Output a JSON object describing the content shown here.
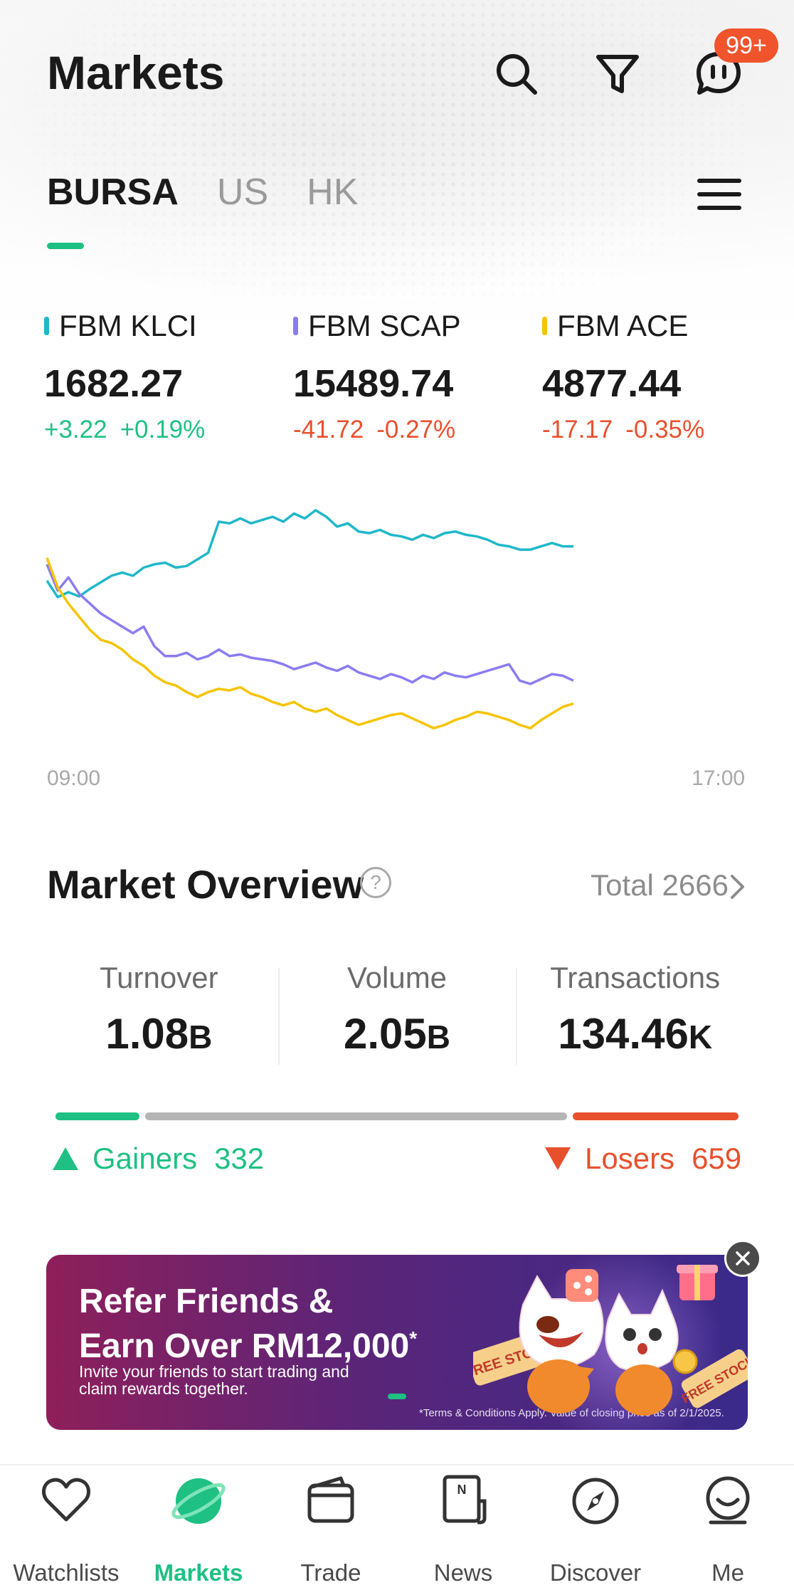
{
  "header": {
    "title": "Markets",
    "search_icon": "search-icon",
    "filter_icon": "filter-icon",
    "messages_icon": "chat-icon",
    "messages_badge": "99+"
  },
  "tabs": [
    {
      "label": "BURSA",
      "active": true
    },
    {
      "label": "US",
      "active": false
    },
    {
      "label": "HK",
      "active": false
    }
  ],
  "indices": [
    {
      "name": "FBM KLCI",
      "value": "1682.27",
      "change": "+3.22",
      "change_pct": "+0.19%",
      "color": "#1fb8c9",
      "direction": "up"
    },
    {
      "name": "FBM SCAP",
      "value": "15489.74",
      "change": "-41.72",
      "change_pct": "-0.27%",
      "color": "#8b7cf0",
      "direction": "down"
    },
    {
      "name": "FBM ACE",
      "value": "4877.44",
      "change": "-17.17",
      "change_pct": "-0.35%",
      "color": "#f5c400",
      "direction": "down"
    }
  ],
  "chart_data": {
    "type": "line",
    "x_start": "09:00",
    "x_end": "17:00",
    "series": [
      {
        "name": "FBM KLCI",
        "color": "#1fb8c9",
        "values": [
          0.3,
          -0.2,
          -0.05,
          -0.18,
          0.05,
          0.25,
          0.45,
          0.55,
          0.45,
          0.7,
          0.8,
          0.85,
          0.7,
          0.75,
          0.95,
          1.15,
          2.1,
          2.05,
          2.2,
          2.05,
          2.15,
          2.25,
          2.1,
          2.35,
          2.2,
          2.45,
          2.25,
          1.95,
          2.05,
          1.8,
          1.75,
          1.85,
          1.7,
          1.65,
          1.55,
          1.7,
          1.6,
          1.75,
          1.8,
          1.7,
          1.65,
          1.55,
          1.4,
          1.35,
          1.25,
          1.25,
          1.35,
          1.45,
          1.35,
          1.35
        ]
      },
      {
        "name": "FBM SCAP",
        "color": "#8b7cf0",
        "values": [
          0.8,
          0.0,
          0.4,
          -0.1,
          -0.4,
          -0.7,
          -0.9,
          -1.1,
          -1.3,
          -1.1,
          -1.7,
          -2.0,
          -2.0,
          -1.9,
          -2.1,
          -2.0,
          -1.8,
          -2.0,
          -1.95,
          -2.05,
          -2.1,
          -2.15,
          -2.25,
          -2.4,
          -2.3,
          -2.2,
          -2.35,
          -2.45,
          -2.3,
          -2.5,
          -2.6,
          -2.7,
          -2.55,
          -2.65,
          -2.8,
          -2.6,
          -2.7,
          -2.5,
          -2.6,
          -2.65,
          -2.55,
          -2.45,
          -2.35,
          -2.25,
          -2.75,
          -2.85,
          -2.7,
          -2.55,
          -2.6,
          -2.75
        ]
      },
      {
        "name": "FBM ACE",
        "color": "#f5c400",
        "values": [
          1.0,
          0.1,
          -0.4,
          -0.8,
          -1.2,
          -1.5,
          -1.6,
          -1.8,
          -2.1,
          -2.3,
          -2.6,
          -2.8,
          -2.9,
          -3.1,
          -3.25,
          -3.1,
          -3.0,
          -3.05,
          -2.95,
          -3.15,
          -3.25,
          -3.4,
          -3.5,
          -3.4,
          -3.6,
          -3.7,
          -3.6,
          -3.8,
          -3.95,
          -4.1,
          -4.0,
          -3.9,
          -3.8,
          -3.75,
          -3.9,
          -4.05,
          -4.2,
          -4.1,
          -3.95,
          -3.85,
          -3.7,
          -3.75,
          -3.85,
          -3.95,
          -4.1,
          -4.2,
          -3.95,
          -3.75,
          -3.55,
          -3.45
        ]
      }
    ]
  },
  "overview": {
    "title": "Market Overview",
    "help": "?",
    "total_label": "Total 2666",
    "stats": [
      {
        "label": "Turnover",
        "value": "1.08",
        "unit": "B"
      },
      {
        "label": "Volume",
        "value": "2.05",
        "unit": "B"
      },
      {
        "label": "Transactions",
        "value": "134.46",
        "unit": "K"
      }
    ],
    "gainers_label": "Gainers",
    "gainers": "332",
    "losers_label": "Losers",
    "losers": "659",
    "unchanged": 1675,
    "colors": {
      "up": "#1ec083",
      "flat": "#b5b5b5",
      "down": "#e8502d"
    }
  },
  "banner": {
    "title_line1": "Refer Friends &",
    "title_line2": "Earn Over RM12,000",
    "title_mark": "*",
    "subtitle": "Invite your friends to start trading and claim rewards together.",
    "terms": "*Terms & Conditions Apply. Value of closing price as of 2/1/2025.",
    "sticker_left": "FREE STOCK",
    "sticker_right": "FREE STOCK"
  },
  "tabbar": [
    {
      "label": "Watchlists",
      "icon": "heart-icon",
      "active": false
    },
    {
      "label": "Markets",
      "icon": "planet-icon",
      "active": true
    },
    {
      "label": "Trade",
      "icon": "wallet-icon",
      "active": false
    },
    {
      "label": "News",
      "icon": "newspaper-icon",
      "active": false
    },
    {
      "label": "Discover",
      "icon": "compass-icon",
      "active": false
    },
    {
      "label": "Me",
      "icon": "profile-icon",
      "active": false
    }
  ]
}
